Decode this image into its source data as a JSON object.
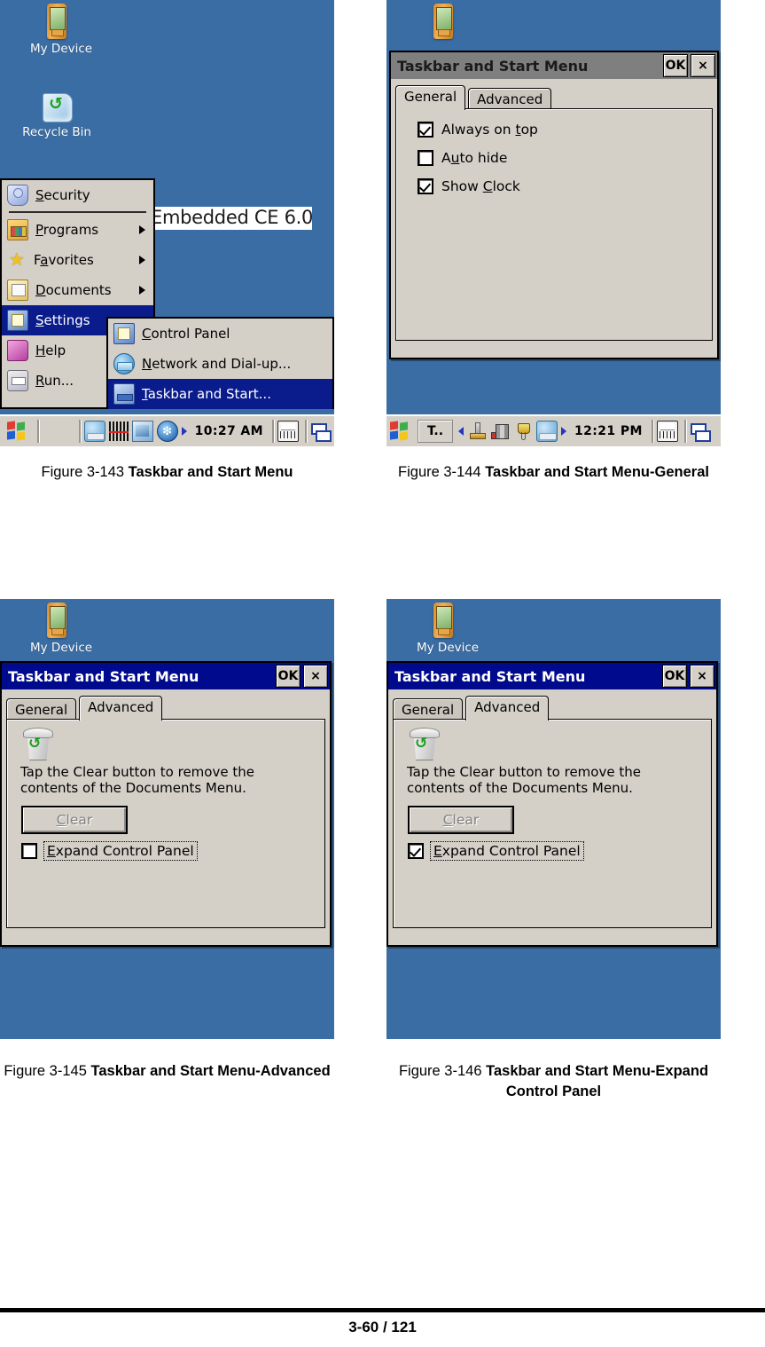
{
  "page": {
    "footer_page_number": "3-60 / 121"
  },
  "figures": [
    {
      "number": "Figure 3-143",
      "title": "Taskbar and Start Menu"
    },
    {
      "number": "Figure 3-144",
      "title": "Taskbar and Start Menu-General"
    },
    {
      "number": "Figure 3-145",
      "title": "Taskbar and Start Menu-Advanced"
    },
    {
      "number": "Figure 3-146",
      "title": "Taskbar and Start Menu-Expand Control Panel"
    }
  ],
  "screenshot_1": {
    "desktop": {
      "icons": [
        {
          "icon": "pda-device-icon",
          "label": "My Device"
        },
        {
          "icon": "recycle-bin-icon",
          "label": "Recycle Bin"
        }
      ],
      "watermark": "Embedded CE 6.0",
      "background_color": "#3a6da4"
    },
    "start_menu": {
      "items": [
        {
          "icon": "security-icon",
          "label": "Security",
          "accel": "S",
          "submenu": false,
          "selected": false
        },
        {
          "icon": "programs-icon",
          "label": "Programs",
          "accel": "P",
          "submenu": true,
          "selected": false
        },
        {
          "icon": "favorites-icon",
          "label": "Favorites",
          "accel": "a",
          "submenu": true,
          "selected": false
        },
        {
          "icon": "documents-icon",
          "label": "Documents",
          "accel": "D",
          "submenu": true,
          "selected": false
        },
        {
          "icon": "settings-icon",
          "label": "Settings",
          "accel": "S",
          "submenu": false,
          "selected": true
        },
        {
          "icon": "help-icon",
          "label": "Help",
          "accel": "H",
          "submenu": false,
          "selected": false
        },
        {
          "icon": "run-icon",
          "label": "Run...",
          "accel": "R",
          "submenu": false,
          "selected": false
        }
      ]
    },
    "settings_submenu": {
      "items": [
        {
          "icon": "control-panel-icon",
          "label": "Control Panel",
          "accel": "C",
          "selected": false
        },
        {
          "icon": "network-icon",
          "label": "Network and Dial-up...",
          "accel": "N",
          "selected": false
        },
        {
          "icon": "taskbar-icon",
          "label": "Taskbar and Start...",
          "accel": "T",
          "selected": true
        }
      ]
    },
    "taskbar": {
      "start_button": "start-flag-icon",
      "tray_icons": [
        "monitor-icon",
        "barcode-icon",
        "network-card-icon",
        "bluetooth-icon"
      ],
      "clock": "10:27 AM",
      "right_icons": [
        "soft-keyboard-icon",
        "window-switch-icon"
      ]
    }
  },
  "screenshot_2": {
    "dialog": {
      "title": "Taskbar and Start Menu",
      "title_state": "inactive",
      "ok_button": "OK",
      "close_button": "×",
      "tabs": [
        {
          "label": "General",
          "active": true
        },
        {
          "label": "Advanced",
          "active": false
        }
      ],
      "general_tab": {
        "checkboxes": [
          {
            "label_before": "Always on ",
            "accel": "t",
            "label_after": "op",
            "checked": true
          },
          {
            "label_before": "A",
            "accel": "u",
            "label_after": "to hide",
            "checked": false
          },
          {
            "label_before": "Show ",
            "accel": "C",
            "label_after": "lock",
            "checked": true
          }
        ]
      }
    },
    "desktop": {
      "icons": [
        {
          "icon": "pda-device-icon",
          "label": ""
        }
      ]
    },
    "taskbar": {
      "task_button": "T..",
      "tray_icons": [
        "stylus-icon",
        "signal-bars-icon",
        "power-plug-icon",
        "monitor-icon"
      ],
      "clock": "12:21 PM",
      "right_icons": [
        "soft-keyboard-icon",
        "window-switch-icon"
      ]
    }
  },
  "screenshot_3": {
    "dialog": {
      "title": "Taskbar and Start Menu",
      "title_state": "active",
      "ok_button": "OK",
      "close_button": "×",
      "tabs": [
        {
          "label": "General",
          "active": false
        },
        {
          "label": "Advanced",
          "active": true
        }
      ],
      "advanced_tab": {
        "icon": "recycle-bin-icon",
        "description": "Tap the Clear button to remove the contents of the Documents Menu.",
        "clear_button": {
          "label_accel": "C",
          "label_rest": "lear",
          "enabled": false
        },
        "expand_checkbox": {
          "accel": "E",
          "label_rest": "xpand Control Panel",
          "checked": false,
          "focused": true
        }
      }
    },
    "desktop": {
      "icons": [
        {
          "icon": "pda-device-icon",
          "label": "My Device"
        }
      ]
    }
  },
  "screenshot_4": {
    "dialog": {
      "title": "Taskbar and Start Menu",
      "title_state": "active",
      "ok_button": "OK",
      "close_button": "×",
      "tabs": [
        {
          "label": "General",
          "active": false
        },
        {
          "label": "Advanced",
          "active": true
        }
      ],
      "advanced_tab": {
        "icon": "recycle-bin-icon",
        "description": "Tap the Clear button to remove the contents of the Documents Menu.",
        "clear_button": {
          "label_accel": "C",
          "label_rest": "lear",
          "enabled": false
        },
        "expand_checkbox": {
          "accel": "E",
          "label_rest": "xpand Control Panel",
          "checked": true,
          "focused": true
        }
      }
    },
    "desktop": {
      "icons": [
        {
          "icon": "pda-device-icon",
          "label": "My Device"
        }
      ]
    }
  }
}
